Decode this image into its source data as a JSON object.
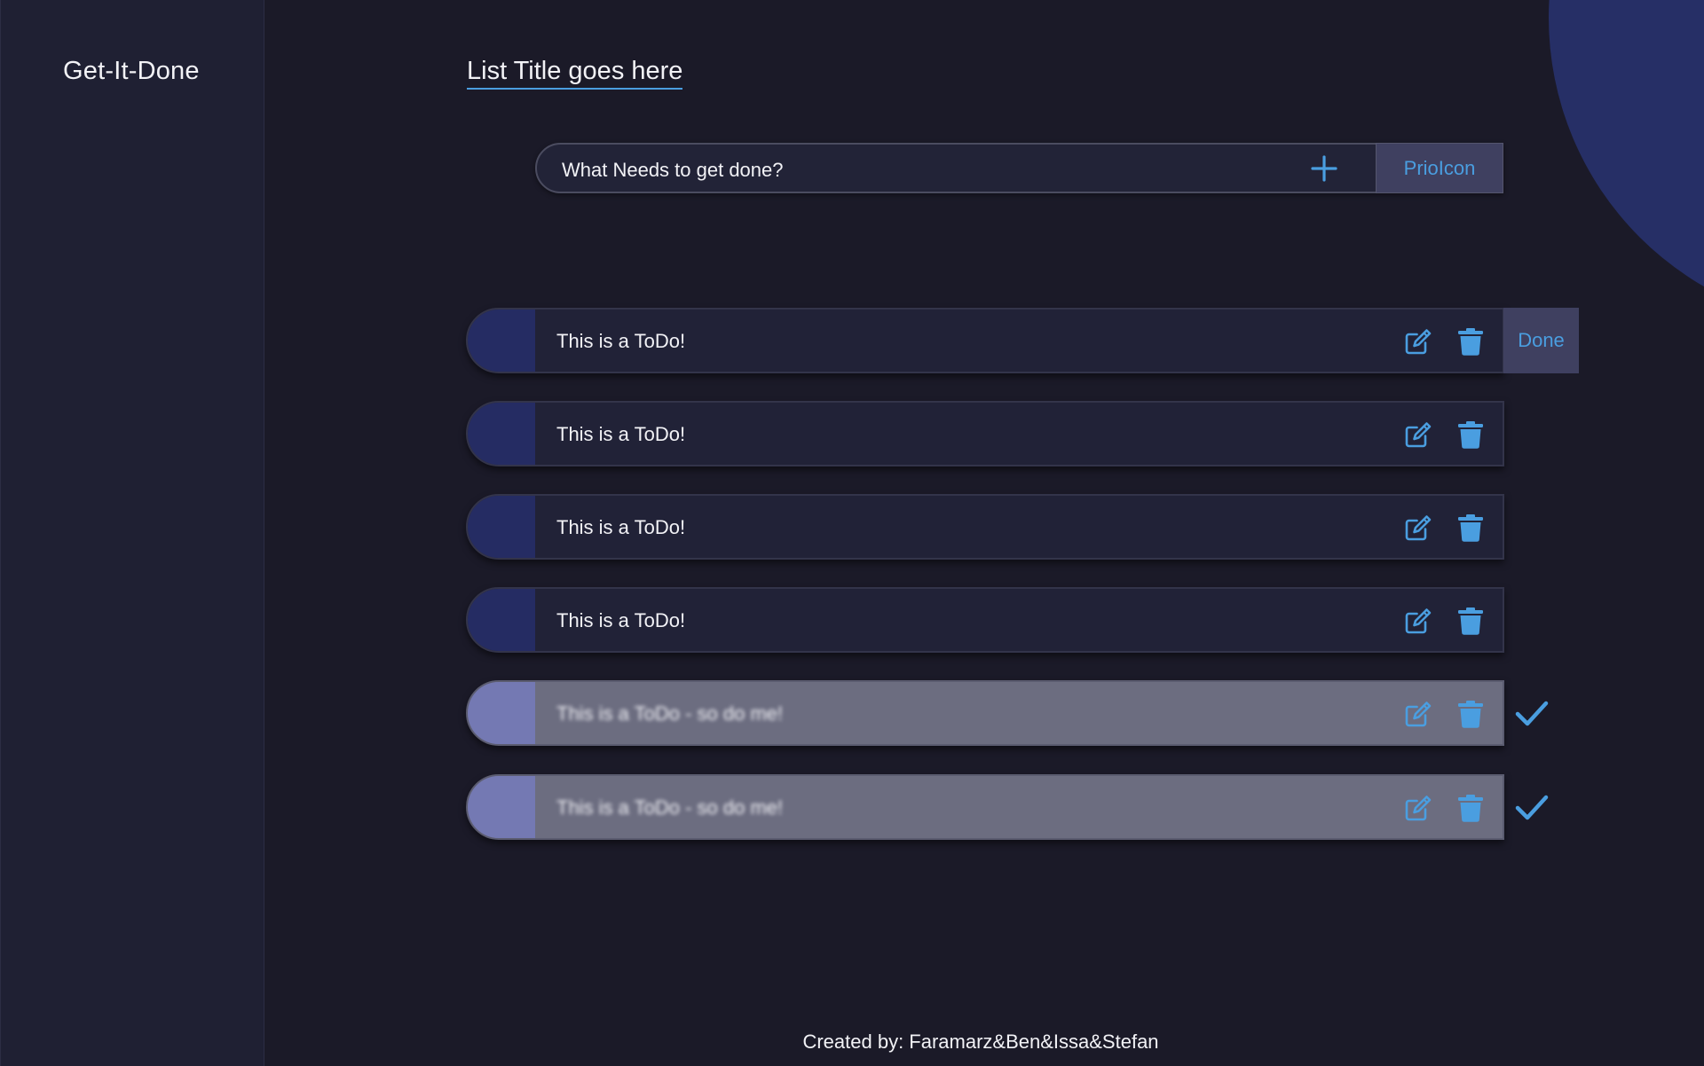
{
  "sidebar": {
    "brand": "Get-It-Done"
  },
  "main": {
    "list_title": "List Title goes here",
    "new_todo": {
      "text": "What Needs to get done?",
      "prio_label": "PrioIcon"
    },
    "done_label": "Done",
    "todos": [
      {
        "text": "This is a ToDo!",
        "completed": false
      },
      {
        "text": "This is a ToDo!",
        "completed": false
      },
      {
        "text": "This is a ToDo!",
        "completed": false
      },
      {
        "text": "This is a ToDo!",
        "completed": false
      },
      {
        "text": "This is a ToDo - so do me!",
        "completed": true
      },
      {
        "text": "This is a ToDo - so do me!",
        "completed": true
      }
    ]
  },
  "footer": {
    "credits": "Created by: Faramarz&Ben&Issa&Stefan"
  },
  "colors": {
    "background": "#1b1a28",
    "sidebar": "#1f2033",
    "accent": "#4a9ee0",
    "priority": "#252c63",
    "completed_row": "#6c6d80",
    "decor_circle": "#262f66"
  },
  "icons": {
    "add": "plus-icon",
    "edit": "edit-icon",
    "delete": "trash-icon",
    "completed": "check-icon"
  }
}
